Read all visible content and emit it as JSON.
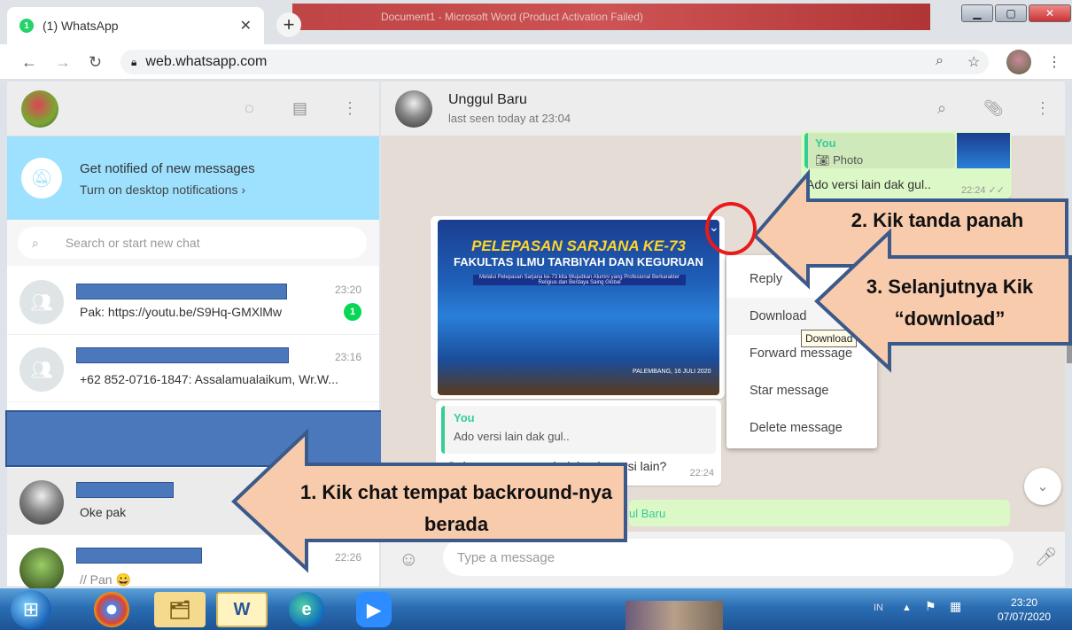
{
  "browser": {
    "tab_title": "(1) WhatsApp",
    "tab_badge": "1",
    "window_title": "Document1 - Microsoft Word (Product Activation Failed)",
    "url": "web.whatsapp.com"
  },
  "sidebar": {
    "notification": {
      "title": "Get notified of new messages",
      "subtitle": "Turn on desktop notifications ›"
    },
    "search_placeholder": "Search or start new chat",
    "chats": [
      {
        "time": "23:20",
        "message": "Pak: https://youtu.be/S9Hq-GMXlMw",
        "unread": "1"
      },
      {
        "time": "23:16",
        "message": "+62 852-0716-1847: Assalamualaikum, Wr.W..."
      },
      {
        "time": "",
        "message": "Oke pak"
      },
      {
        "time": "22:26",
        "message": "// Pan 😀"
      }
    ]
  },
  "conversation": {
    "contact_name": "Unggul Baru",
    "last_seen": "last seen today at 23:04",
    "top_bubble": {
      "quote_author": "You",
      "quote_label": "Photo",
      "text": "Ado versi lain dak gul..",
      "time": "22:24 ✓✓"
    },
    "image_banner": {
      "line1": "PELEPASAN SARJANA KE-73",
      "line2": "FAKULTAS ILMU TARBIYAH DAN KEGURUAN",
      "line3": "Melalui Pelepasan Sarjana ke-73 kita Wujudkan Alumni yang Profesional Berkarakter Religius dan Berdaya Saing Global",
      "date": "PALEMBANG, 16 JULI 2020"
    },
    "reply_bubble": {
      "quote_author": "You",
      "quote_text": "Ado versi lain dak gul..",
      "text": "Gak punya saya pak dak ada versi lain?",
      "time": "22:24"
    },
    "green_bar_text": "ul Baru",
    "menu": [
      "Reply",
      "Download",
      "Forward message",
      "Star message",
      "Delete message"
    ],
    "tooltip": "Download",
    "composer_placeholder": "Type a message"
  },
  "annotations": {
    "step1": "1.    Kik chat tempat backround-nya berada",
    "step2": "2. Kik tanda panah",
    "step3": "3. Selanjutnya Kik “download”"
  },
  "taskbar": {
    "language": "IN",
    "time": "23:20",
    "date": "07/07/2020"
  },
  "colors": {
    "whatsapp_green": "#25d366",
    "notif_blue": "#9de1fe",
    "redaction_blue": "#4a78bb",
    "arrow_fill": "#f8cbad",
    "arrow_stroke": "#3b5a8a",
    "highlight_circle": "#e81b1b"
  }
}
